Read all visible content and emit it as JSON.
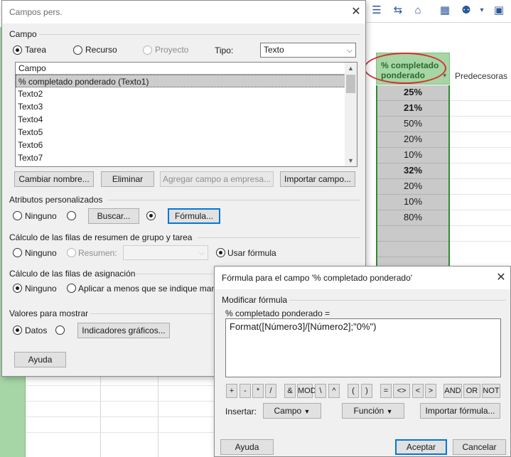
{
  "background": {
    "column_header": "% completado ponderado",
    "predecessors_header": "Predecesoras",
    "percent_values": [
      "25%",
      "21%",
      "50%",
      "20%",
      "10%",
      "32%",
      "20%",
      "10%",
      "80%"
    ],
    "bold_rows": [
      0,
      1,
      5
    ]
  },
  "custom_fields_dialog": {
    "title": "Campos pers.",
    "field_section": "Campo",
    "type_options": {
      "task": "Tarea",
      "resource": "Recurso",
      "project": "Proyecto"
    },
    "type_label": "Tipo:",
    "type_value": "Texto",
    "list_header": "Campo",
    "list_items": [
      "% completado ponderado (Texto1)",
      "Texto2",
      "Texto3",
      "Texto4",
      "Texto5",
      "Texto6",
      "Texto7",
      "Texto8"
    ],
    "buttons": {
      "rename": "Cambiar nombre...",
      "delete": "Eliminar",
      "add_to_enterprise": "Agregar campo a empresa...",
      "import_field": "Importar campo..."
    },
    "custom_attributes_section": "Atributos personalizados",
    "attr_none": "Ninguno",
    "attr_lookup_button": "Buscar...",
    "attr_formula_button": "Fórmula...",
    "summary_section": "Cálculo de las filas de resumen de grupo y tarea",
    "summary_none": "Ninguno",
    "summary_rollup": "Resumen:",
    "summary_use_formula": "Usar fórmula",
    "assignment_section": "Cálculo de las filas de asignación",
    "assignment_none": "Ninguno",
    "assignment_rollup": "Aplicar a menos que se indique manu",
    "display_section": "Valores para mostrar",
    "display_data": "Datos",
    "display_indicators_button": "Indicadores gráficos...",
    "help_button": "Ayuda"
  },
  "formula_dialog": {
    "title": "Fórmula para el campo '% completado ponderado'",
    "edit_label": "Modificar fórmula",
    "field_eq": "% completado ponderado =",
    "formula": "Format([Número3]/[Número2];\"0%\")",
    "operators": [
      "+",
      "-",
      "*",
      "/",
      "&",
      "MOD",
      "\\",
      "^",
      "(",
      ")",
      "=",
      "<>",
      "<",
      ">",
      "AND",
      "OR",
      "NOT"
    ],
    "insert_label": "Insertar:",
    "field_button": "Campo",
    "function_button": "Función",
    "import_formula_button": "Importar fórmula...",
    "help_button": "Ayuda",
    "ok_button": "Aceptar",
    "cancel_button": "Cancelar"
  }
}
